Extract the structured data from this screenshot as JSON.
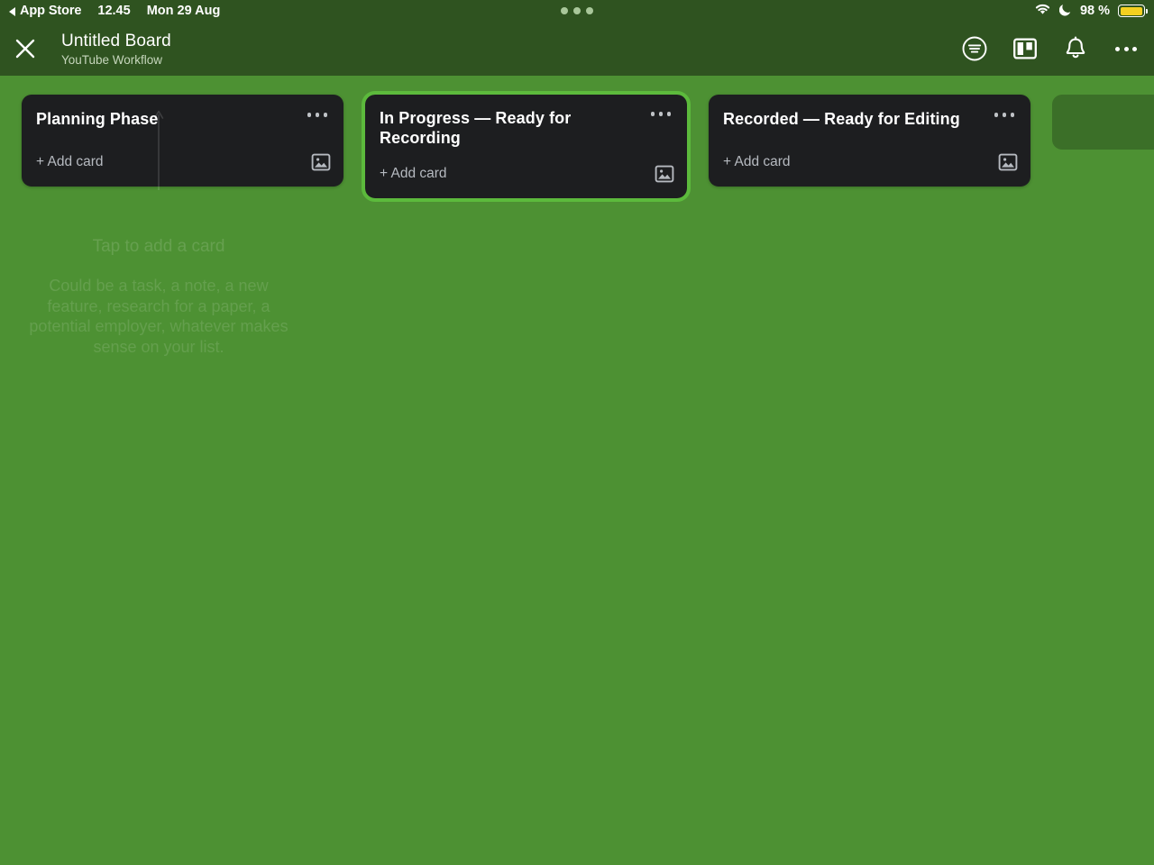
{
  "statusbar": {
    "back_app_label": "App Store",
    "time": "12.45",
    "date": "Mon 29 Aug",
    "wifi_icon": "wifi-icon",
    "dnd_icon": "moon-icon",
    "battery_percent": "98 %",
    "battery_icon": "battery-icon",
    "multitask_icon": "multitask-dots-icon"
  },
  "header": {
    "close_icon": "close-x-icon",
    "title": "Untitled Board",
    "subtitle": "YouTube Workflow",
    "actions": [
      {
        "name": "filter-circle-icon",
        "label": "Filter"
      },
      {
        "name": "board-view-icon",
        "label": "Board view"
      },
      {
        "name": "bell-icon",
        "label": "Notifications"
      },
      {
        "name": "overflow-menu-icon",
        "label": "More"
      }
    ]
  },
  "board": {
    "lists": [
      {
        "title": "Planning Phase",
        "add_card_label": "+ Add card",
        "menu_icon": "list-overflow-icon",
        "image_icon": "image-attachment-icon",
        "focused": false,
        "two_line": false
      },
      {
        "title": "In Progress — Ready for Recording",
        "add_card_label": "+ Add card",
        "menu_icon": "list-overflow-icon",
        "image_icon": "image-attachment-icon",
        "focused": true,
        "two_line": true
      },
      {
        "title": "Recorded — Ready for Editing",
        "add_card_label": "+ Add card",
        "menu_icon": "list-overflow-icon",
        "image_icon": "image-attachment-icon",
        "focused": false,
        "two_line": false
      }
    ],
    "add_list_placeholder": ""
  },
  "hint": {
    "title": "Tap to add a card",
    "body": "Could be a task, a note, a new feature, research for a paper, a potential employer, whatever makes sense on your list.",
    "arrow_icon": "up-arrow-hint-icon"
  },
  "colors": {
    "board_background": "#4d9133",
    "header_background": "#2f5320",
    "list_surface": "#1d1e20",
    "focus_ring": "#5cba3c",
    "add_list_surface": "#3b6f28",
    "battery_fill": "#f5d020",
    "muted_text": "#b6bac0"
  }
}
